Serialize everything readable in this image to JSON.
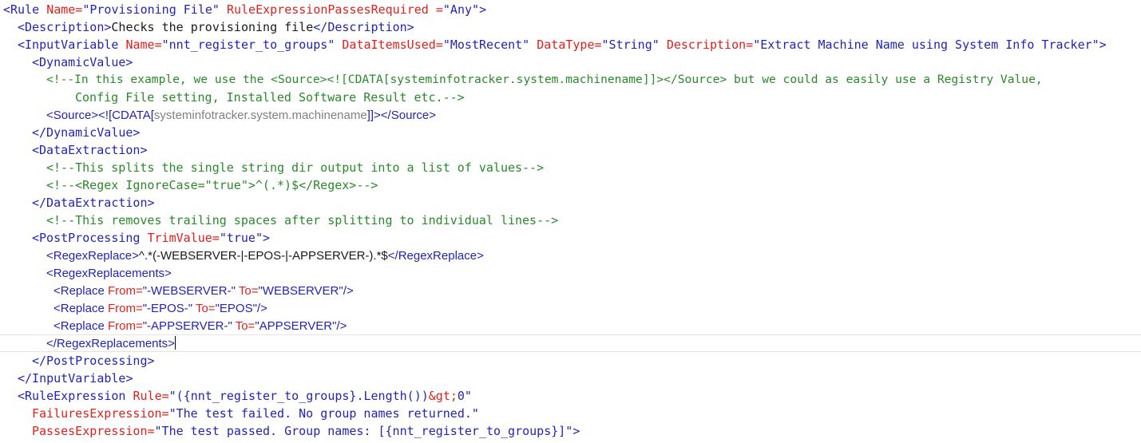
{
  "colors": {
    "tag": "#2323b8",
    "attribute": "#e0201c",
    "string": "#2323b8",
    "text": "#1a1a1a",
    "comment": "#2a8a2a",
    "cdata": "#808080",
    "background": "#ffffff"
  },
  "lines": [
    {
      "indent": 0,
      "tokens": [
        {
          "k": "tag",
          "t": "<Rule"
        },
        {
          "k": "text",
          "t": " "
        },
        {
          "k": "attr",
          "t": "Name="
        },
        {
          "k": "str",
          "t": "\"Provisioning File\""
        },
        {
          "k": "text",
          "t": " "
        },
        {
          "k": "attr",
          "t": "RuleExpressionPassesRequired ="
        },
        {
          "k": "str",
          "t": "\"Any\""
        },
        {
          "k": "tag",
          "t": ">"
        }
      ]
    },
    {
      "indent": 2,
      "tokens": [
        {
          "k": "tag",
          "t": "<Description>"
        },
        {
          "k": "text",
          "t": "Checks the provisioning file"
        },
        {
          "k": "tag",
          "t": "</Description>"
        }
      ]
    },
    {
      "indent": 2,
      "tokens": [
        {
          "k": "tag",
          "t": "<InputVariable"
        },
        {
          "k": "text",
          "t": " "
        },
        {
          "k": "attr",
          "t": "Name="
        },
        {
          "k": "str",
          "t": "\"nnt_register_to_groups\""
        },
        {
          "k": "text",
          "t": " "
        },
        {
          "k": "attr",
          "t": "DataItemsUsed="
        },
        {
          "k": "str",
          "t": "\"MostRecent\""
        },
        {
          "k": "text",
          "t": " "
        },
        {
          "k": "attr",
          "t": "DataType="
        },
        {
          "k": "str",
          "t": "\"String\""
        },
        {
          "k": "text",
          "t": " "
        },
        {
          "k": "attr",
          "t": "Description="
        },
        {
          "k": "str",
          "t": "\"Extract Machine Name using System Info Tracker\""
        },
        {
          "k": "tag",
          "t": ">"
        }
      ]
    },
    {
      "indent": 4,
      "tokens": [
        {
          "k": "tag",
          "t": "<DynamicValue>"
        }
      ]
    },
    {
      "indent": 6,
      "tokens": [
        {
          "k": "comment",
          "t": "<!--In this example, we use the <Source><![CDATA[systeminfotracker.system.machinename]]></Source> but we could as easily use a Registry Value,"
        }
      ]
    },
    {
      "indent": 10,
      "tokens": [
        {
          "k": "comment",
          "t": "Config File setting, Installed Software Result etc.-->"
        }
      ]
    },
    {
      "indent": 6,
      "prop": true,
      "tokens": [
        {
          "k": "tag",
          "t": "<Source>"
        },
        {
          "k": "tag",
          "t": "<![CDATA["
        },
        {
          "k": "cdata",
          "t": "systeminfotracker.system.machinename"
        },
        {
          "k": "tag",
          "t": "]]>"
        },
        {
          "k": "tag",
          "t": "</Source>"
        }
      ]
    },
    {
      "indent": 4,
      "tokens": [
        {
          "k": "tag",
          "t": "</DynamicValue>"
        }
      ]
    },
    {
      "indent": 4,
      "tokens": [
        {
          "k": "tag",
          "t": "<DataExtraction>"
        }
      ]
    },
    {
      "indent": 6,
      "tokens": [
        {
          "k": "comment",
          "t": "<!--This splits the single string dir output into a list of values-->"
        }
      ]
    },
    {
      "indent": 6,
      "tokens": [
        {
          "k": "comment",
          "t": "<!--<Regex IgnoreCase=\"true\">^(.*)$</Regex>-->"
        }
      ]
    },
    {
      "indent": 4,
      "tokens": [
        {
          "k": "tag",
          "t": "</DataExtraction>"
        }
      ]
    },
    {
      "indent": 6,
      "tokens": [
        {
          "k": "comment",
          "t": "<!--This removes trailing spaces after splitting to individual lines-->"
        }
      ]
    },
    {
      "indent": 4,
      "tokens": [
        {
          "k": "tag",
          "t": "<PostProcessing"
        },
        {
          "k": "text",
          "t": " "
        },
        {
          "k": "attr",
          "t": "TrimValue="
        },
        {
          "k": "str",
          "t": "\"true\""
        },
        {
          "k": "tag",
          "t": ">"
        }
      ]
    },
    {
      "indent": 6,
      "prop": true,
      "tokens": [
        {
          "k": "tag",
          "t": "<RegexReplace>"
        },
        {
          "k": "text",
          "t": "^.*(-WEBSERVER-|-EPOS-|-APPSERVER-).*$"
        },
        {
          "k": "tag",
          "t": "</RegexReplace>"
        }
      ]
    },
    {
      "indent": 6,
      "prop": true,
      "tokens": [
        {
          "k": "tag",
          "t": "<RegexReplacements>"
        }
      ]
    },
    {
      "indent": 7,
      "prop": true,
      "tokens": [
        {
          "k": "tag",
          "t": "<Replace"
        },
        {
          "k": "text",
          "t": " "
        },
        {
          "k": "attr",
          "t": "From="
        },
        {
          "k": "str",
          "t": "\"-WEBSERVER-\""
        },
        {
          "k": "text",
          "t": " "
        },
        {
          "k": "attr",
          "t": "To="
        },
        {
          "k": "str",
          "t": "\"WEBSERVER\""
        },
        {
          "k": "tag",
          "t": "/>"
        }
      ]
    },
    {
      "indent": 7,
      "prop": true,
      "tokens": [
        {
          "k": "tag",
          "t": "<Replace"
        },
        {
          "k": "text",
          "t": " "
        },
        {
          "k": "attr",
          "t": "From="
        },
        {
          "k": "str",
          "t": "\"-EPOS-\""
        },
        {
          "k": "text",
          "t": " "
        },
        {
          "k": "attr",
          "t": "To="
        },
        {
          "k": "str",
          "t": "\"EPOS\""
        },
        {
          "k": "tag",
          "t": "/>"
        }
      ]
    },
    {
      "indent": 7,
      "prop": true,
      "tokens": [
        {
          "k": "tag",
          "t": "<Replace"
        },
        {
          "k": "text",
          "t": " "
        },
        {
          "k": "attr",
          "t": "From="
        },
        {
          "k": "str",
          "t": "\"-APPSERVER-\""
        },
        {
          "k": "text",
          "t": " "
        },
        {
          "k": "attr",
          "t": "To="
        },
        {
          "k": "str",
          "t": "\"APPSERVER\""
        },
        {
          "k": "tag",
          "t": "/>"
        }
      ]
    },
    {
      "indent": 6,
      "prop": true,
      "current": true,
      "caret": true,
      "tokens": [
        {
          "k": "tag",
          "t": "</RegexReplacements>"
        }
      ]
    },
    {
      "indent": 4,
      "tokens": [
        {
          "k": "tag",
          "t": "</PostProcessing>"
        }
      ]
    },
    {
      "indent": 2,
      "tokens": [
        {
          "k": "tag",
          "t": "</InputVariable>"
        }
      ]
    },
    {
      "indent": 2,
      "tokens": [
        {
          "k": "tag",
          "t": "<RuleExpression"
        },
        {
          "k": "text",
          "t": " "
        },
        {
          "k": "attr",
          "t": "Rule="
        },
        {
          "k": "str",
          "t": "\"({nnt_register_to_groups}.Length())"
        },
        {
          "k": "attr",
          "t": "&gt;"
        },
        {
          "k": "str",
          "t": "0\""
        }
      ]
    },
    {
      "indent": 4,
      "tokens": [
        {
          "k": "attr",
          "t": "FailuresExpression="
        },
        {
          "k": "str",
          "t": "\"The test failed. No group names returned.\""
        }
      ]
    },
    {
      "indent": 4,
      "tokens": [
        {
          "k": "attr",
          "t": "PassesExpression="
        },
        {
          "k": "str",
          "t": "\"The test passed. Group names: [{nnt_register_to_groups}]\""
        },
        {
          "k": "tag",
          "t": ">"
        }
      ]
    }
  ]
}
